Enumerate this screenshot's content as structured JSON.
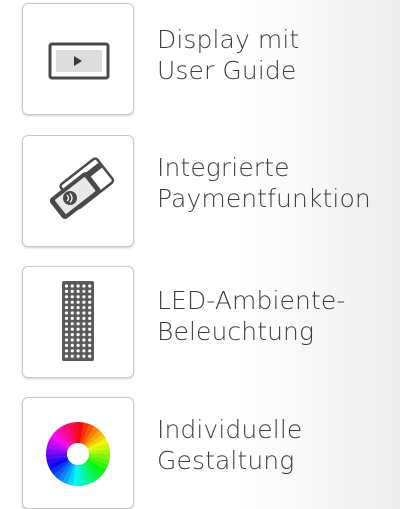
{
  "features": [
    {
      "line1": "Display mit",
      "line2": "User Guide",
      "icon": "display-icon"
    },
    {
      "line1": "Integrierte",
      "line2": "Paymentfunktion",
      "icon": "payment-icon"
    },
    {
      "line1": "LED-Ambiente-",
      "line2": "Beleuchtung",
      "icon": "led-panel-icon"
    },
    {
      "line1": "Individuelle",
      "line2": "Gestaltung",
      "icon": "color-wheel-icon"
    }
  ],
  "colors": {
    "text": "#3d3d3d",
    "icon_dark": "#4a4a4a",
    "box_border": "#c9c9c9"
  }
}
